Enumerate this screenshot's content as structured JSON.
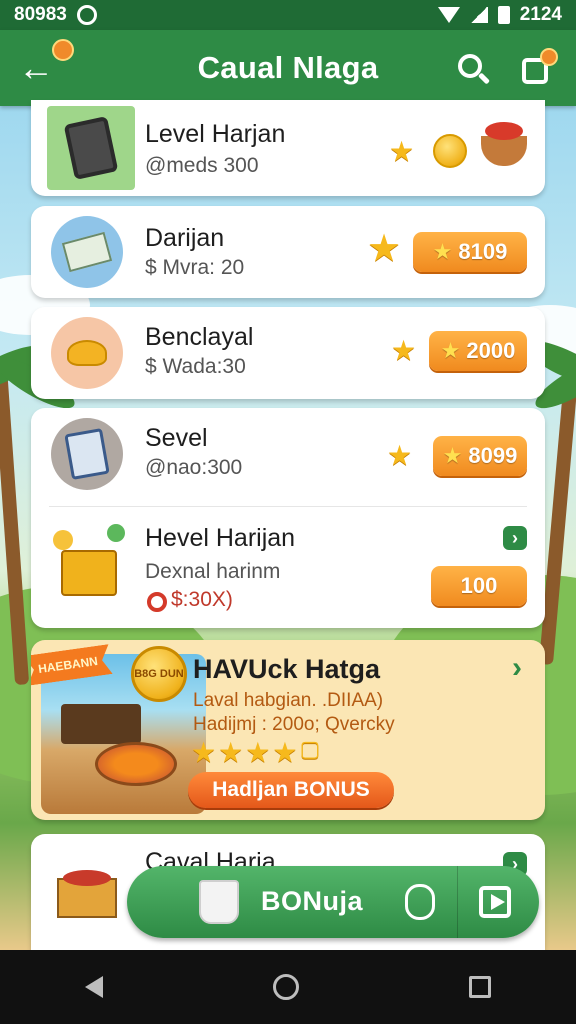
{
  "status_bar": {
    "left_text": "80983",
    "time": "2124"
  },
  "app_bar": {
    "title": "Caual Nlaga"
  },
  "cards": [
    {
      "title": "Level Harjan",
      "subtitle": "@meds 300"
    },
    {
      "title": "Darijan",
      "subtitle": "$ Mvra: 20",
      "pill": "8109"
    },
    {
      "title": "Benclayal",
      "subtitle": "$ Wada:30",
      "pill": "2000"
    },
    {
      "title": "Sevel",
      "subtitle": "@nao:300",
      "pill": "8099"
    },
    {
      "title": "Hevel Harijan",
      "subtitle": "Dexnal harinm",
      "subtitle2": "$:30X)",
      "pill": "100"
    }
  ],
  "featured": {
    "title": "HAVUck Hatga",
    "badge": "HAEBANN",
    "coin_label": "B8G DUN",
    "line1": "Laval habgian. .DIIAA)",
    "line2": "Hadijmj : 200o; Qvercky",
    "bonus_label": "Hadljan BONUS"
  },
  "partial_card": {
    "title": "Caval Haria"
  },
  "bonus_bar": {
    "label": "BONuja"
  },
  "colors": {
    "brand_green": "#2e8b45",
    "accent_orange": "#f08a1f",
    "star_gold": "#f6b91c"
  }
}
